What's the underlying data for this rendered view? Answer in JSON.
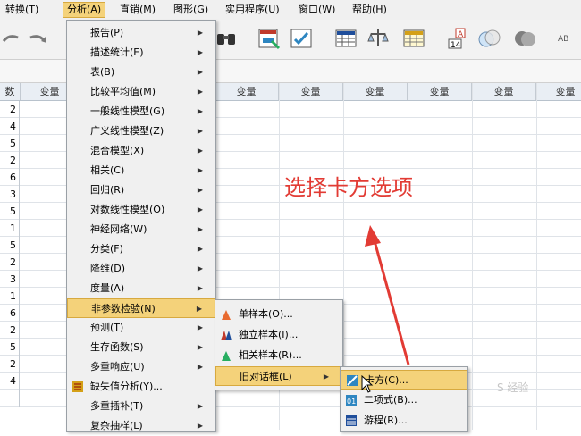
{
  "menubar": {
    "items": [
      {
        "label": "转换(T)"
      },
      {
        "label": "分析(A)"
      },
      {
        "label": "直销(M)"
      },
      {
        "label": "图形(G)"
      },
      {
        "label": "实用程序(U)"
      },
      {
        "label": "窗口(W)"
      },
      {
        "label": "帮助(H)"
      }
    ]
  },
  "grid": {
    "left_header": "数",
    "col_label": "变量",
    "row_values": [
      "2",
      "4",
      "5",
      "2",
      "6",
      "3",
      "5",
      "1",
      "5",
      "2",
      "3",
      "1",
      "6",
      "2",
      "5",
      "2",
      "4",
      ""
    ]
  },
  "analyze_menu": {
    "items": [
      {
        "label": "报告(P)",
        "arrow": true
      },
      {
        "label": "描述统计(E)",
        "arrow": true
      },
      {
        "label": "表(B)",
        "arrow": true
      },
      {
        "label": "比较平均值(M)",
        "arrow": true
      },
      {
        "label": "一般线性模型(G)",
        "arrow": true
      },
      {
        "label": "广义线性模型(Z)",
        "arrow": true
      },
      {
        "label": "混合模型(X)",
        "arrow": true
      },
      {
        "label": "相关(C)",
        "arrow": true
      },
      {
        "label": "回归(R)",
        "arrow": true
      },
      {
        "label": "对数线性模型(O)",
        "arrow": true
      },
      {
        "label": "神经网络(W)",
        "arrow": true
      },
      {
        "label": "分类(F)",
        "arrow": true
      },
      {
        "label": "降维(D)",
        "arrow": true
      },
      {
        "label": "度量(A)",
        "arrow": true
      },
      {
        "label": "非参数检验(N)",
        "arrow": true
      },
      {
        "label": "预测(T)",
        "arrow": true
      },
      {
        "label": "生存函数(S)",
        "arrow": true
      },
      {
        "label": "多重响应(U)",
        "arrow": true
      },
      {
        "label": "缺失值分析(Y)...",
        "arrow": false
      },
      {
        "label": "多重插补(T)",
        "arrow": true
      },
      {
        "label": "复杂抽样(L)",
        "arrow": true
      }
    ]
  },
  "nonparam_menu": {
    "items": [
      {
        "label": "单样本(O)...",
        "icon": "one-sample-icon"
      },
      {
        "label": "独立样本(I)...",
        "icon": "independent-samples-icon"
      },
      {
        "label": "相关样本(R)...",
        "icon": "related-samples-icon"
      },
      {
        "label": "旧对话框(L)",
        "icon": "",
        "arrow": true
      }
    ]
  },
  "legacy_menu": {
    "items": [
      {
        "label": "卡方(C)...",
        "icon": "chi-square-icon"
      },
      {
        "label": "二项式(B)...",
        "icon": "binomial-icon"
      },
      {
        "label": "游程(R)...",
        "icon": "runs-icon"
      }
    ]
  },
  "annotation": {
    "text": "选择卡方选项"
  },
  "watermark": {
    "text": "S 经验"
  },
  "colors": {
    "highlight": "#f4d27a",
    "annotation": "#e23b34"
  }
}
